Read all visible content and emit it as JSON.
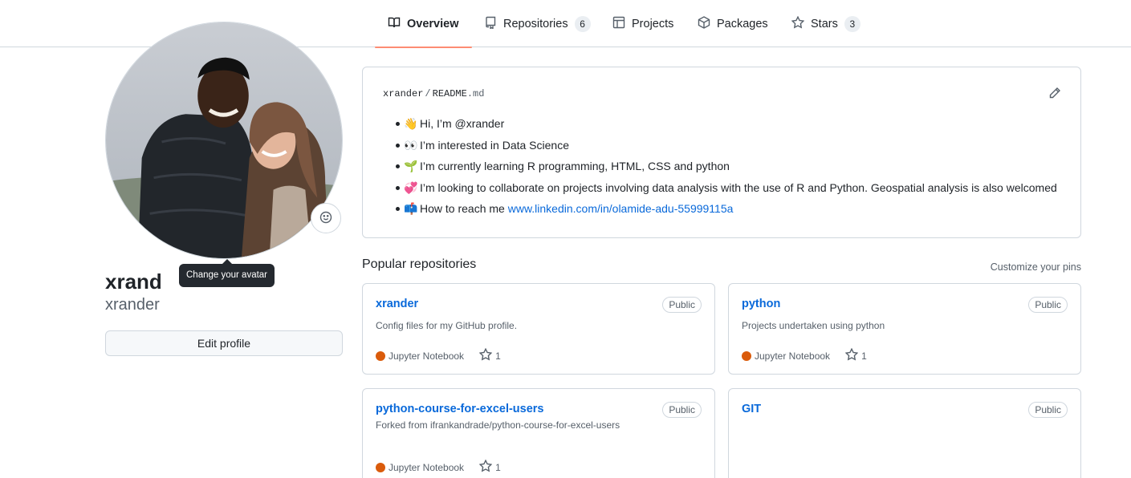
{
  "nav": {
    "tabs": [
      {
        "label": "Overview",
        "icon": "book-icon",
        "count": ""
      },
      {
        "label": "Repositories",
        "icon": "repo-icon",
        "count": "6"
      },
      {
        "label": "Projects",
        "icon": "table-icon",
        "count": ""
      },
      {
        "label": "Packages",
        "icon": "package-icon",
        "count": ""
      },
      {
        "label": "Stars",
        "icon": "star-icon",
        "count": "3"
      }
    ]
  },
  "profile": {
    "fullname": "xrand",
    "username": "xrander",
    "avatar_tooltip": "Change your avatar",
    "edit_label": "Edit profile"
  },
  "readme": {
    "owner": "xrander",
    "separator": "/",
    "file": "README",
    "ext": ".md",
    "items": [
      {
        "emoji": "👋",
        "text": "Hi, I’m @xrander",
        "link": ""
      },
      {
        "emoji": "👀",
        "text": "I’m interested in Data Science",
        "link": ""
      },
      {
        "emoji": "🌱",
        "text": "I’m currently learning R programming, HTML, CSS and python",
        "link": ""
      },
      {
        "emoji": "💞️",
        "text": "I’m looking to collaborate on projects involving data analysis with the use of R and Python. Geospatial analysis is also welcomed",
        "link": ""
      },
      {
        "emoji": "📫",
        "text": "How to reach me ",
        "link": "www.linkedin.com/in/olamide-adu-55999115a"
      }
    ]
  },
  "popular": {
    "title": "Popular repositories",
    "customize": "Customize your pins",
    "repos": [
      {
        "name": "xrander",
        "visibility": "Public",
        "desc": "Config files for my GitHub profile.",
        "language": "Jupyter Notebook",
        "stars": "1"
      },
      {
        "name": "python",
        "visibility": "Public",
        "desc": "Projects undertaken using python",
        "language": "Jupyter Notebook",
        "stars": "1"
      },
      {
        "name": "python-course-for-excel-users",
        "visibility": "Public",
        "desc": "Forked from ifrankandrade/python-course-for-excel-users",
        "language": "Jupyter Notebook",
        "stars": "1"
      },
      {
        "name": "GIT",
        "visibility": "Public",
        "desc": "",
        "language": "",
        "stars": ""
      }
    ]
  },
  "colors": {
    "accent": "#0969da",
    "tab_underline": "#fd8c73",
    "jupyter": "#DA5B0B"
  }
}
